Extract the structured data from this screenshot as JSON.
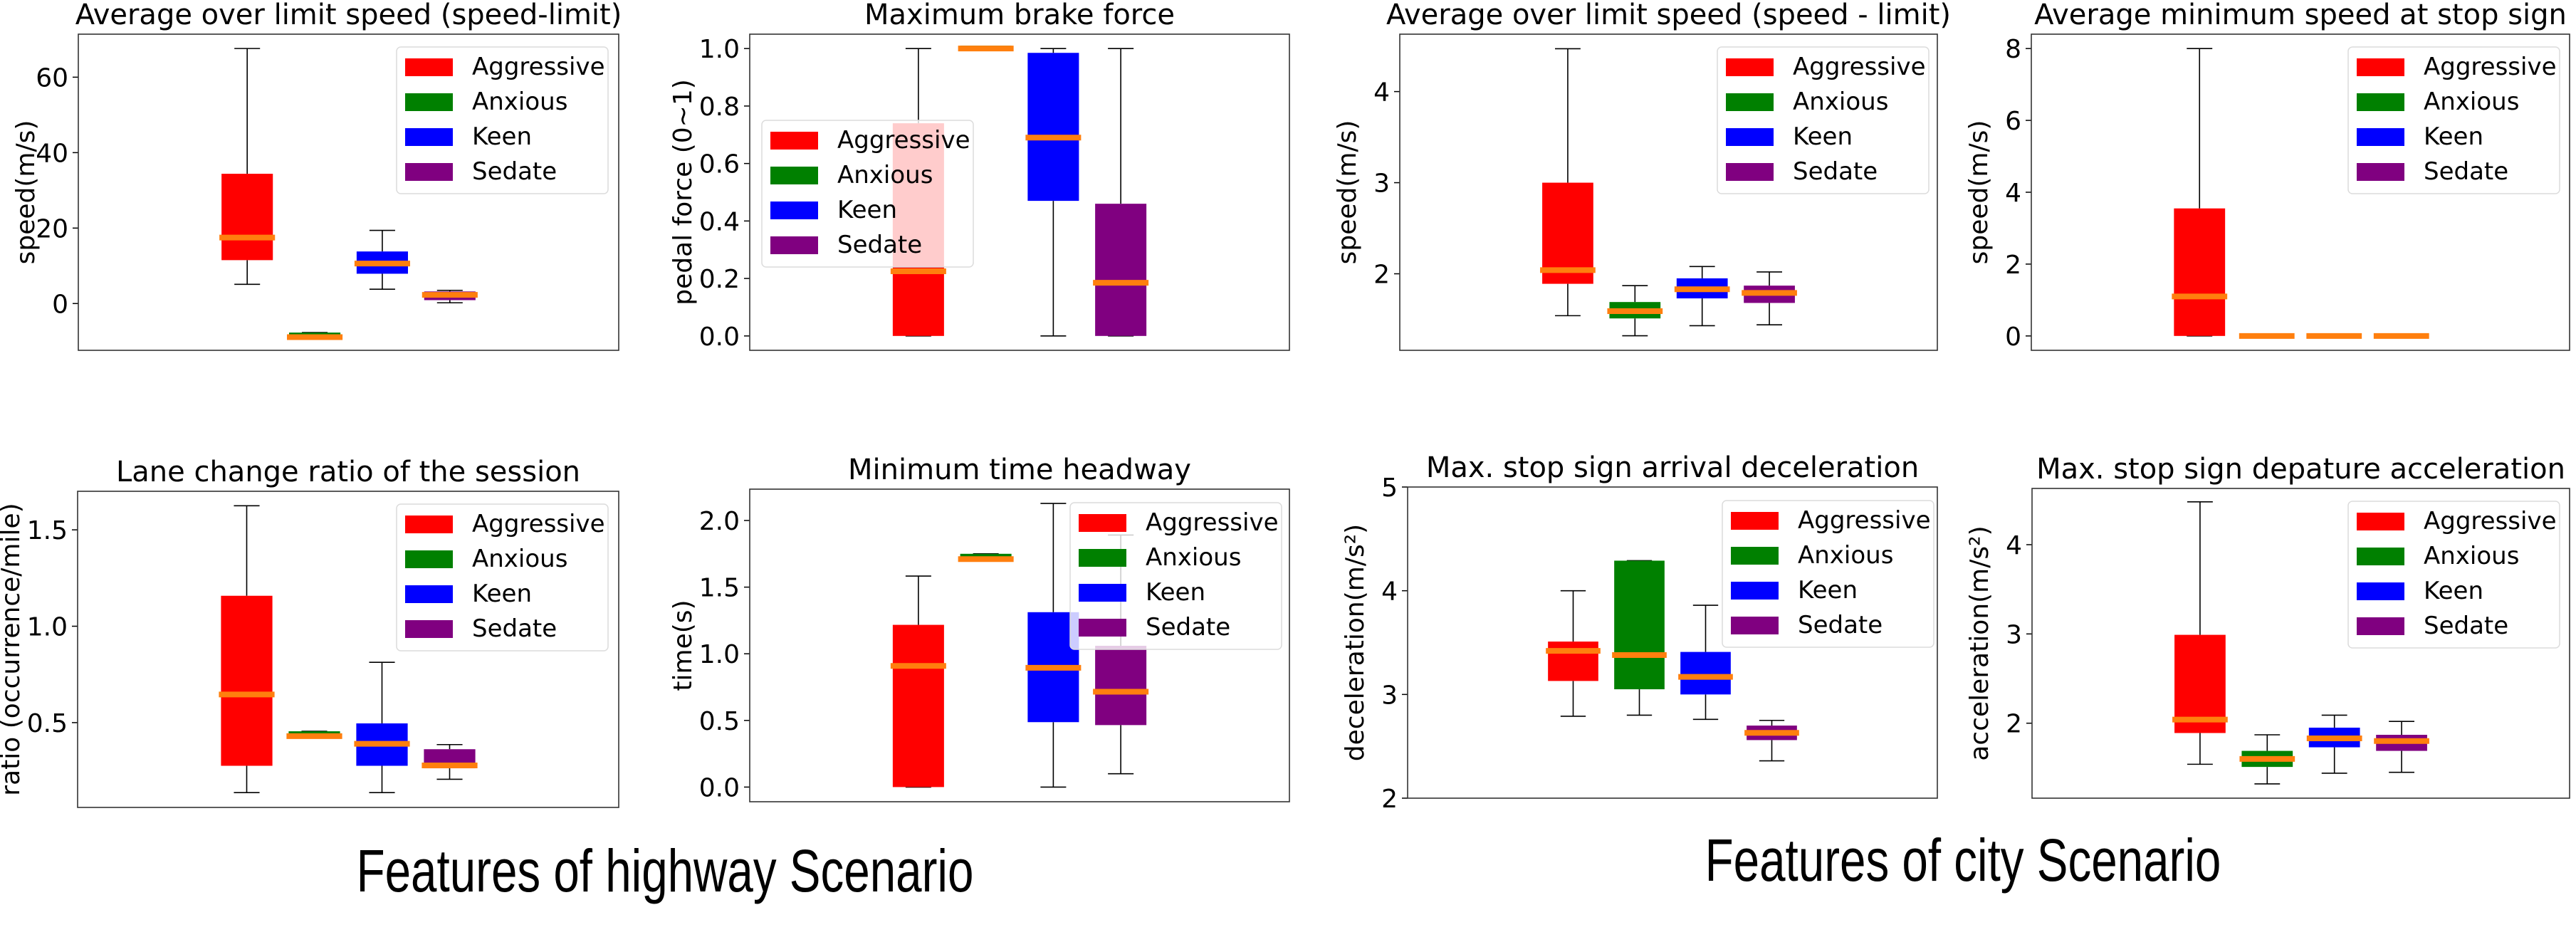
{
  "figure": {
    "captions": [
      "Features of highway Scenario",
      "Features of city Scenario"
    ]
  },
  "legend_labels": [
    "Aggressive",
    "Anxious",
    "Keen",
    "Sedate"
  ],
  "colors": {
    "Aggressive": "#ff0000",
    "Anxious": "#008000",
    "Keen": "#0000ff",
    "Sedate": "#800080",
    "median": "#ff7f0e",
    "whisker": "#000000"
  },
  "chart_data": [
    {
      "type": "box",
      "scenario": "highway",
      "title": "Average over limit speed (speed-limit)",
      "ylabel": "speed(m/s)",
      "ylim": [
        -12.4,
        71.4
      ],
      "yticks": [
        0,
        20,
        40,
        60
      ],
      "ytick_labels": [
        "0",
        "20",
        "40",
        "60"
      ],
      "legend": "top-right",
      "grid": false,
      "series": [
        {
          "name": "Aggressive",
          "whislo": 5.1,
          "q1": 11.5,
          "med": 17.5,
          "q3": 34.4,
          "whishi": 67.6
        },
        {
          "name": "Anxious",
          "whislo": -8.9,
          "q1": -8.9,
          "med": -8.9,
          "q3": -7.7,
          "whishi": -7.7
        },
        {
          "name": "Keen",
          "whislo": 3.8,
          "q1": 7.9,
          "med": 10.6,
          "q3": 13.8,
          "whishi": 19.4
        },
        {
          "name": "Sedate",
          "whislo": 0.2,
          "q1": 0.9,
          "med": 2.3,
          "q3": 3.2,
          "whishi": 3.5
        }
      ]
    },
    {
      "type": "box",
      "scenario": "highway",
      "title": "Maximum brake force",
      "ylabel": "pedal force (0~1)",
      "ylim": [
        -0.05,
        1.05
      ],
      "yticks": [
        0.0,
        0.2,
        0.4,
        0.6,
        0.8,
        1.0
      ],
      "ytick_labels": [
        "0.0",
        "0.2",
        "0.4",
        "0.6",
        "0.8",
        "1.0"
      ],
      "legend": "center-left",
      "grid": false,
      "series": [
        {
          "name": "Aggressive",
          "whislo": 0.0,
          "q1": 0.0,
          "med": 0.225,
          "q3": 0.74,
          "whishi": 1.0
        },
        {
          "name": "Anxious",
          "whislo": 1.0,
          "q1": 0.995,
          "med": 1.0,
          "q3": 1.01,
          "whishi": 1.0
        },
        {
          "name": "Keen",
          "whislo": 0.0,
          "q1": 0.47,
          "med": 0.69,
          "q3": 0.985,
          "whishi": 1.0
        },
        {
          "name": "Sedate",
          "whislo": 0.0,
          "q1": 0.0,
          "med": 0.185,
          "q3": 0.46,
          "whishi": 1.0
        }
      ]
    },
    {
      "type": "box",
      "scenario": "city",
      "title": "Average over limit speed (speed - limit)",
      "ylabel": "speed(m/s)",
      "ylim": [
        1.16,
        4.63
      ],
      "yticks": [
        2,
        3,
        4
      ],
      "ytick_labels": [
        "2",
        "3",
        "4"
      ],
      "legend": "top-right",
      "grid": false,
      "series": [
        {
          "name": "Aggressive",
          "whislo": 1.54,
          "q1": 1.89,
          "med": 2.04,
          "q3": 3.0,
          "whishi": 4.47
        },
        {
          "name": "Anxious",
          "whislo": 1.32,
          "q1": 1.51,
          "med": 1.59,
          "q3": 1.69,
          "whishi": 1.87
        },
        {
          "name": "Keen",
          "whislo": 1.43,
          "q1": 1.73,
          "med": 1.83,
          "q3": 1.95,
          "whishi": 2.08
        },
        {
          "name": "Sedate",
          "whislo": 1.44,
          "q1": 1.68,
          "med": 1.79,
          "q3": 1.87,
          "whishi": 2.02
        }
      ]
    },
    {
      "type": "box",
      "scenario": "city",
      "title": "Average minimum speed at stop sign",
      "ylabel": "speed(m/s)",
      "ylim": [
        -0.4,
        8.4
      ],
      "yticks": [
        0,
        2,
        4,
        6,
        8
      ],
      "ytick_labels": [
        "0",
        "2",
        "4",
        "6",
        "8"
      ],
      "legend": "top-right",
      "grid": false,
      "series": [
        {
          "name": "Aggressive",
          "whislo": 0.0,
          "q1": 0.0,
          "med": 1.1,
          "q3": 3.55,
          "whishi": 8.0
        },
        {
          "name": "Anxious",
          "whislo": 0.0,
          "q1": 0.0,
          "med": 0.0,
          "q3": 0.0,
          "whishi": 0.0
        },
        {
          "name": "Keen",
          "whislo": 0.0,
          "q1": 0.0,
          "med": 0.0,
          "q3": 0.0,
          "whishi": 0.0
        },
        {
          "name": "Sedate",
          "whislo": 0.0,
          "q1": 0.0,
          "med": 0.0,
          "q3": 0.0,
          "whishi": 0.0
        }
      ]
    },
    {
      "type": "box",
      "scenario": "highway",
      "title": "Lane change ratio of the session",
      "ylabel": "ratio (occurrence/mile)",
      "ylim": [
        0.06,
        1.7
      ],
      "yticks": [
        0.5,
        1.0,
        1.5
      ],
      "ytick_labels": [
        "0.5",
        "1.0",
        "1.5"
      ],
      "legend": "top-right",
      "grid": false,
      "series": [
        {
          "name": "Aggressive",
          "whislo": 0.137,
          "q1": 0.276,
          "med": 0.646,
          "q3": 1.158,
          "whishi": 1.625
        },
        {
          "name": "Anxious",
          "whislo": 0.43,
          "q1": 0.43,
          "med": 0.43,
          "q3": 0.455,
          "whishi": 0.455
        },
        {
          "name": "Keen",
          "whislo": 0.137,
          "q1": 0.276,
          "med": 0.39,
          "q3": 0.496,
          "whishi": 0.813
        },
        {
          "name": "Sedate",
          "whislo": 0.206,
          "q1": 0.263,
          "med": 0.278,
          "q3": 0.362,
          "whishi": 0.386
        }
      ]
    },
    {
      "type": "box",
      "scenario": "highway",
      "title": "Minimum time headway",
      "ylabel": "time(s)",
      "ylim": [
        -0.11,
        2.235
      ],
      "yticks": [
        0.0,
        0.5,
        1.0,
        1.5,
        2.0
      ],
      "ytick_labels": [
        "0.0",
        "0.5",
        "1.0",
        "1.5",
        "2.0"
      ],
      "legend": "top-right",
      "grid": false,
      "series": [
        {
          "name": "Aggressive",
          "whislo": 0.0,
          "q1": 0.0,
          "med": 0.909,
          "q3": 1.217,
          "whishi": 1.583
        },
        {
          "name": "Anxious",
          "whislo": 1.71,
          "q1": 1.71,
          "med": 1.71,
          "q3": 1.75,
          "whishi": 1.75
        },
        {
          "name": "Keen",
          "whislo": 0.0,
          "q1": 0.487,
          "med": 0.895,
          "q3": 1.312,
          "whishi": 2.128
        },
        {
          "name": "Sedate",
          "whislo": 0.1,
          "q1": 0.465,
          "med": 0.715,
          "q3": 1.06,
          "whishi": 1.891
        }
      ]
    },
    {
      "type": "box",
      "scenario": "city",
      "title": "Max. stop sign arrival deceleration",
      "ylabel": "deceleration(m/s²)",
      "ylim": [
        2,
        5
      ],
      "yticks": [
        2,
        3,
        4,
        5
      ],
      "ytick_labels": [
        "2",
        "3",
        "4",
        "5"
      ],
      "legend": "top-right",
      "grid": false,
      "series": [
        {
          "name": "Aggressive",
          "whislo": 2.79,
          "q1": 3.13,
          "med": 3.42,
          "q3": 3.51,
          "whishi": 4.0
        },
        {
          "name": "Anxious",
          "whislo": 2.8,
          "q1": 3.05,
          "med": 3.38,
          "q3": 4.29,
          "whishi": 4.29
        },
        {
          "name": "Keen",
          "whislo": 2.76,
          "q1": 3.0,
          "med": 3.17,
          "q3": 3.41,
          "whishi": 3.86
        },
        {
          "name": "Sedate",
          "whislo": 2.36,
          "q1": 2.56,
          "med": 2.63,
          "q3": 2.7,
          "whishi": 2.75
        }
      ]
    },
    {
      "type": "box",
      "scenario": "city",
      "title": "Max. stop sign depature acceleration",
      "ylabel": "acceleration(m/s²)",
      "ylim": [
        1.16,
        4.63
      ],
      "yticks": [
        2,
        3,
        4
      ],
      "ytick_labels": [
        "2",
        "3",
        "4"
      ],
      "legend": "top-right",
      "grid": false,
      "series": [
        {
          "name": "Aggressive",
          "whislo": 1.54,
          "q1": 1.89,
          "med": 2.04,
          "q3": 2.99,
          "whishi": 4.48
        },
        {
          "name": "Anxious",
          "whislo": 1.32,
          "q1": 1.51,
          "med": 1.6,
          "q3": 1.69,
          "whishi": 1.87
        },
        {
          "name": "Keen",
          "whislo": 1.44,
          "q1": 1.73,
          "med": 1.83,
          "q3": 1.95,
          "whishi": 2.09
        },
        {
          "name": "Sedate",
          "whislo": 1.45,
          "q1": 1.69,
          "med": 1.8,
          "q3": 1.87,
          "whishi": 2.02
        }
      ]
    }
  ]
}
